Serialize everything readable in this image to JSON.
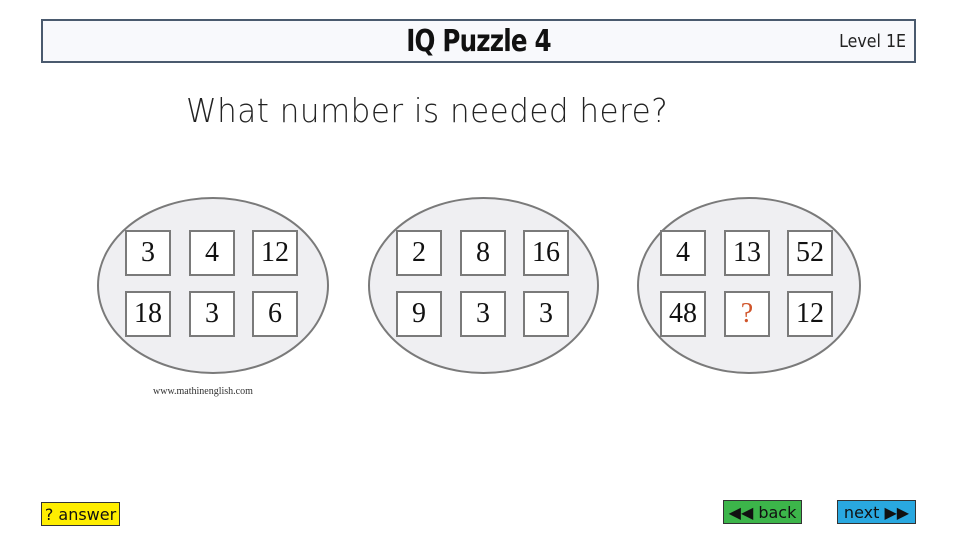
{
  "header": {
    "title": "IQ Puzzle 4",
    "level": "Level 1E"
  },
  "question": "What number is needed here?",
  "puzzle": {
    "groups": [
      {
        "cells": [
          "3",
          "4",
          "12",
          "18",
          "3",
          "6"
        ]
      },
      {
        "cells": [
          "2",
          "8",
          "16",
          "9",
          "3",
          "3"
        ]
      },
      {
        "cells": [
          "4",
          "13",
          "52",
          "48",
          "?",
          "12"
        ]
      }
    ],
    "unknown_color": "#d0542a",
    "credit": "www.mathinenglish.com"
  },
  "buttons": {
    "answer": "? answer",
    "back": "◀◀ back",
    "next": "next ▶▶"
  },
  "colors": {
    "answer_bg": "#ffee00",
    "back_bg": "#3cb54a",
    "next_bg": "#29a8e0"
  }
}
